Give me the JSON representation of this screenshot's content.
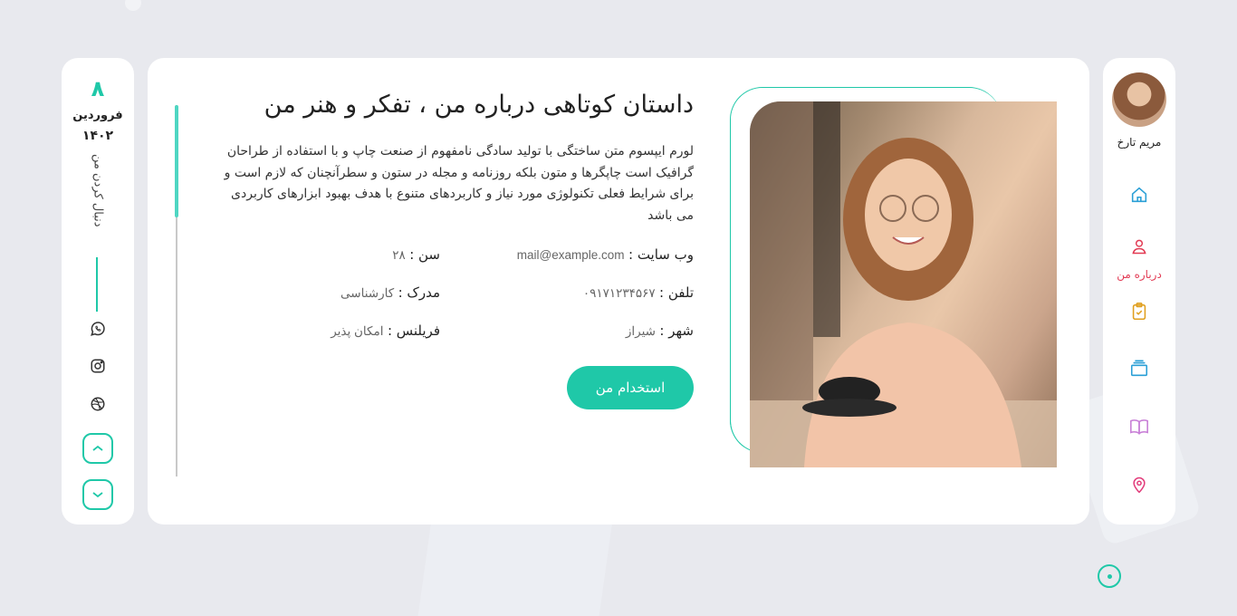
{
  "left_panel": {
    "day": "۸",
    "month": "فروردین",
    "year": "۱۴۰۲",
    "follow_text": "دنبال کردن من"
  },
  "main": {
    "title": "داستان کوتاهی درباره من ، تفکر و هنر من",
    "description": "لورم ایپسوم متن ساختگی با تولید سادگی نامفهوم از صنعت چاپ و با استفاده از طراحان گرافیک است چاپگرها و متون بلکه روزنامه و مجله در ستون و سطرآنچنان که لازم است و برای شرایط فعلی تکنولوژی مورد نیاز و کاربردهای متنوع با هدف بهبود ابزارهای کاربردی می باشد",
    "info": {
      "website_label": "وب سایت :",
      "website_value": "mail@example.com",
      "age_label": "سن :",
      "age_value": "۲۸",
      "phone_label": "تلفن :",
      "phone_value": "۰۹۱۷۱۲۳۴۵۶۷",
      "degree_label": "مدرک :",
      "degree_value": "کارشناسی",
      "city_label": "شهر :",
      "city_value": "شیراز",
      "freelance_label": "فریلنس :",
      "freelance_value": "امکان پذیر"
    },
    "hire_button": "استخدام من"
  },
  "sidebar": {
    "user_name": "مریم تارخ",
    "active_label": "درباره من",
    "icons": [
      "home-icon",
      "user-icon",
      "clipboard-icon",
      "briefcase-icon",
      "book-icon",
      "location-icon"
    ]
  },
  "colors": {
    "accent": "#1fc8a8",
    "active": "#e23b54"
  }
}
